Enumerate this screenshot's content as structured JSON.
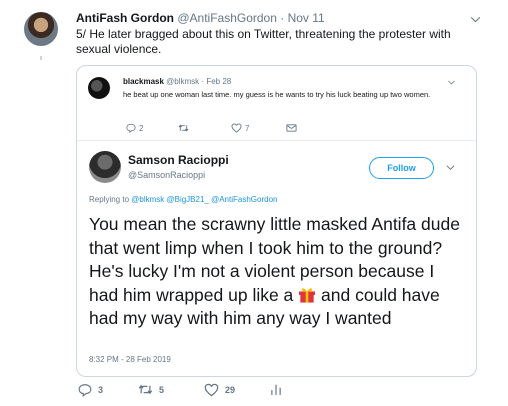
{
  "tweet": {
    "author_name": "AntiFash Gordon",
    "author_handle": "@AntiFashGordon",
    "separator": "·",
    "date": "Nov 11",
    "text": "5/ He later bragged about this on Twitter, threatening the protester with sexual violence.",
    "actions": {
      "replies": "3",
      "retweets": "5",
      "likes": "29"
    }
  },
  "quote": {
    "inner": {
      "author_name": "blackmask",
      "author_handle": "@blkmsk",
      "separator": "·",
      "date": "Feb 28",
      "text": "he beat up one woman last time. my guess is he wants to try his luck beating up two women.",
      "actions": {
        "replies": "2",
        "retweets": "",
        "likes": "7"
      }
    },
    "author_name": "Samson Racioppi",
    "author_handle": "@SamsonRacioppi",
    "follow_label": "Follow",
    "replying_label": "Replying to",
    "replying_handles": "@blkmsk @BigJB21_ @AntiFashGordon",
    "text_before_emoji": "You mean the scrawny little masked Antifa dude that went limp when I took him to the ground? He's lucky I'm not a violent person because I had him wrapped up like a",
    "text_after_emoji": "and could have had my way with him any way I wanted",
    "emoji": "gift-icon",
    "timestamp": "8:32 PM - 28 Feb 2019"
  },
  "colors": {
    "accent": "#1da1f2",
    "muted": "#657786",
    "border": "#ccd6dd",
    "gift_red": "#e0333d",
    "gift_gold": "#f5c400"
  }
}
